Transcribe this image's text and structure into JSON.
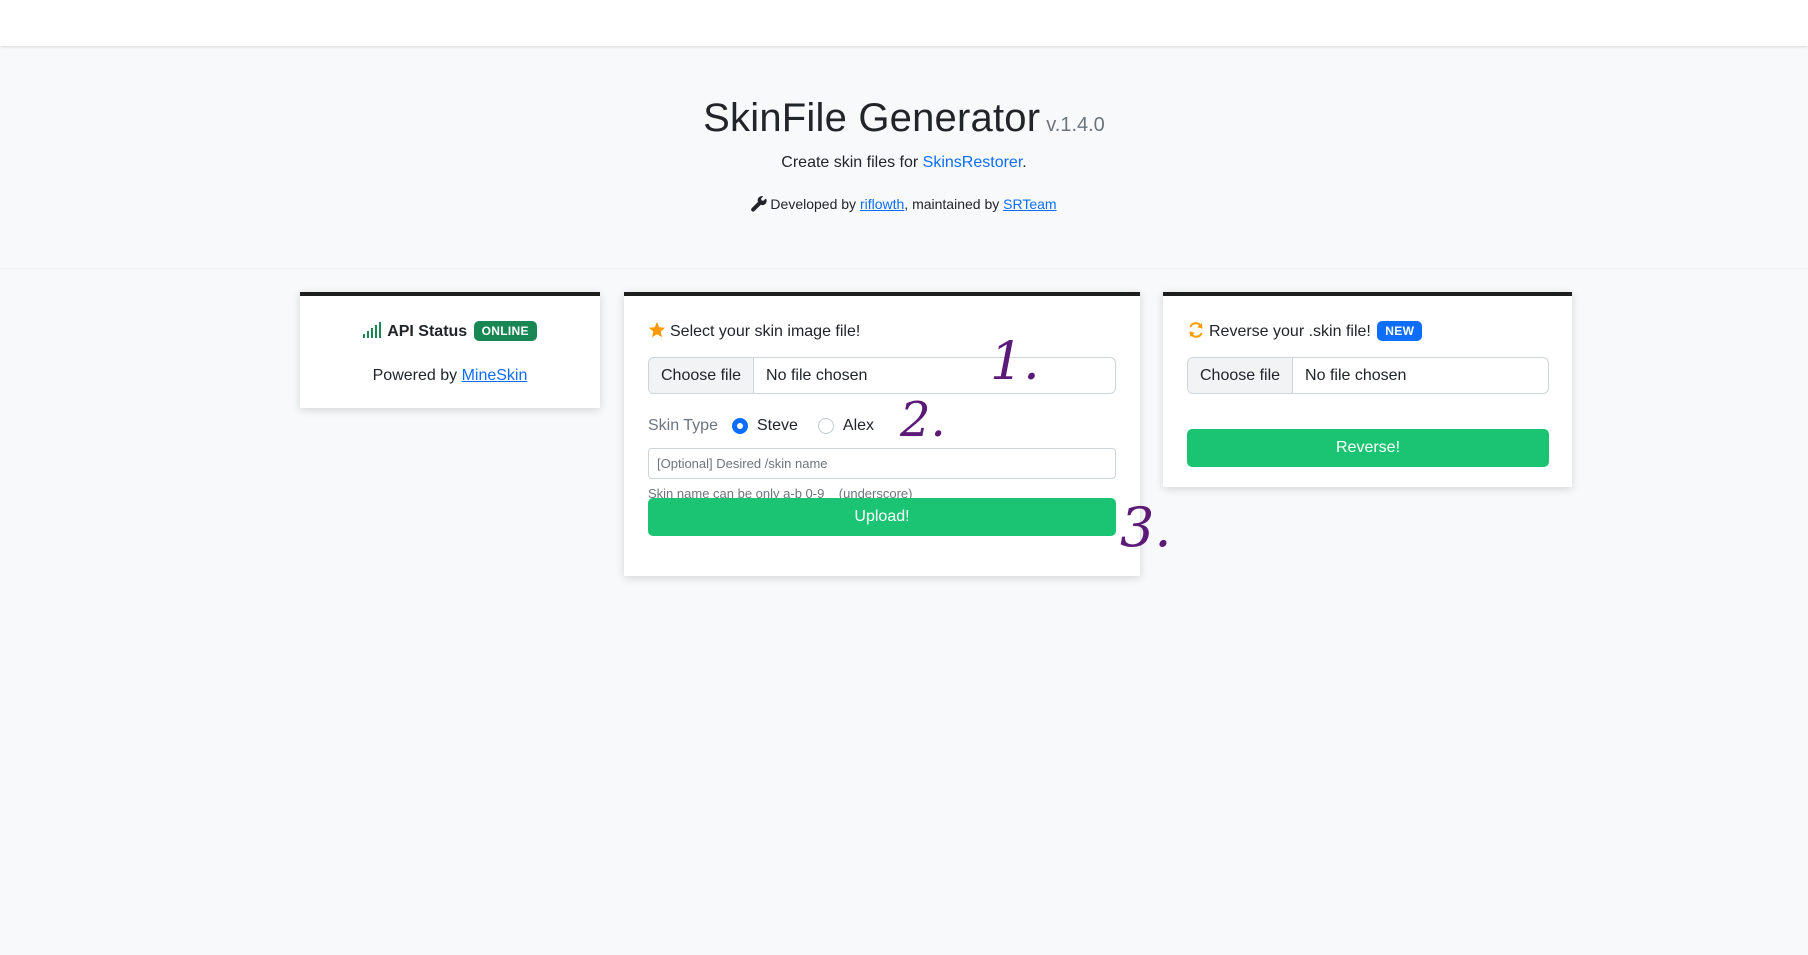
{
  "header": {
    "title": "SkinFile Generator",
    "version": "v.1.4.0",
    "subtitle_prefix": "Create skin files for ",
    "subtitle_link": "SkinsRestorer",
    "subtitle_suffix": ".",
    "credits_prefix": "Developed by ",
    "credits_author": "riflowth",
    "credits_middle": ", maintained by ",
    "credits_team": "SRTeam"
  },
  "status_card": {
    "label": "API Status",
    "badge": "ONLINE",
    "powered_prefix": "Powered by ",
    "powered_link": "MineSkin",
    "icon": "signal-icon"
  },
  "upload_card": {
    "heading": "Select your skin image file!",
    "icon": "star-icon",
    "file_button": "Choose file",
    "file_status": "No file chosen",
    "skin_type_label": "Skin Type",
    "options": [
      {
        "label": "Steve",
        "checked": true
      },
      {
        "label": "Alex",
        "checked": false
      }
    ],
    "name_placeholder": "[Optional] Desired /skin name",
    "name_value": "",
    "help_text": "Skin name can be only a-b 0-9 _ (underscore)",
    "submit_label": "Upload!"
  },
  "reverse_card": {
    "heading": "Reverse your .skin file!",
    "badge": "NEW",
    "icon": "refresh-icon",
    "file_button": "Choose file",
    "file_status": "No file chosen",
    "submit_label": "Reverse!"
  },
  "annotations": [
    "1.",
    "2.",
    "3."
  ],
  "colors": {
    "accent": "#0d6efd",
    "success": "#1ac472",
    "online_badge": "#198754",
    "star": "#fd9a00",
    "annotation_ink": "#5c1a78"
  }
}
